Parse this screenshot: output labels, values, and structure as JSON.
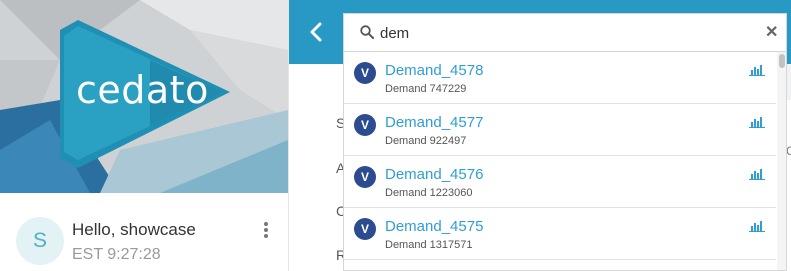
{
  "brand": {
    "logo_text": "cedato"
  },
  "user": {
    "avatar_initial": "S",
    "greeting": "Hello, showcase",
    "clock": "EST 9:27:28"
  },
  "search": {
    "value": "dem",
    "placeholder": ""
  },
  "results": [
    {
      "badge": "V",
      "title": "Demand_4578",
      "subtitle": "Demand 747229"
    },
    {
      "badge": "V",
      "title": "Demand_4577",
      "subtitle": "Demand 922497"
    },
    {
      "badge": "V",
      "title": "Demand_4576",
      "subtitle": "Demand 1223060"
    },
    {
      "badge": "V",
      "title": "Demand_4575",
      "subtitle": "Demand 1317571"
    }
  ],
  "background_letters": [
    "S",
    "A",
    "C",
    "R"
  ],
  "right_letter": "C",
  "colors": {
    "topbar": "#2899c4",
    "badge": "#2d4b8f",
    "link": "#2f9fd3",
    "avatar": "#e3f2f5"
  },
  "icons": {
    "back": "chevron-left-icon",
    "search": "search-icon",
    "clear": "close-icon",
    "result": "bar-chart-icon",
    "menu": "kebab-menu-icon"
  }
}
